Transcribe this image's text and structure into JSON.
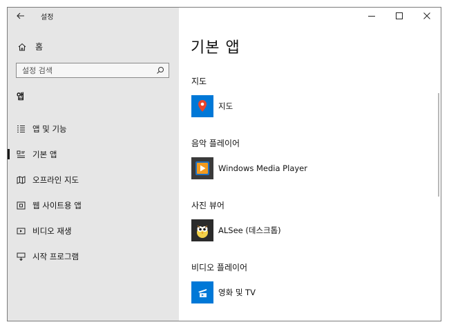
{
  "window": {
    "title": "설정"
  },
  "controls": {
    "minimize": "minimize",
    "maximize": "maximize",
    "close": "close"
  },
  "sidebar": {
    "home_label": "홈",
    "search_placeholder": "설정 검색",
    "section_title": "앱",
    "items": [
      {
        "label": "앱 및 기능",
        "icon": "apps-features-icon",
        "active": false
      },
      {
        "label": "기본 앱",
        "icon": "default-apps-icon",
        "active": true
      },
      {
        "label": "오프라인 지도",
        "icon": "offline-maps-icon",
        "active": false
      },
      {
        "label": "웹 사이트용 앱",
        "icon": "apps-for-websites-icon",
        "active": false
      },
      {
        "label": "비디오 재생",
        "icon": "video-playback-icon",
        "active": false
      },
      {
        "label": "시작 프로그램",
        "icon": "startup-icon",
        "active": false
      }
    ]
  },
  "main": {
    "title": "기본 앱",
    "groups": [
      {
        "label": "지도",
        "app": "지도",
        "app_icon": "maps-app-icon",
        "color": "#0078d7"
      },
      {
        "label": "음악 플레이어",
        "app": "Windows Media Player",
        "app_icon": "windows-media-player-icon",
        "color": "#3a3a3a"
      },
      {
        "label": "사진 뷰어",
        "app": "ALSee (데스크톱)",
        "app_icon": "alsee-icon",
        "color": "#2b2b2b"
      },
      {
        "label": "비디오 플레이어",
        "app": "영화 및 TV",
        "app_icon": "movies-tv-icon",
        "color": "#0078d7"
      }
    ]
  }
}
